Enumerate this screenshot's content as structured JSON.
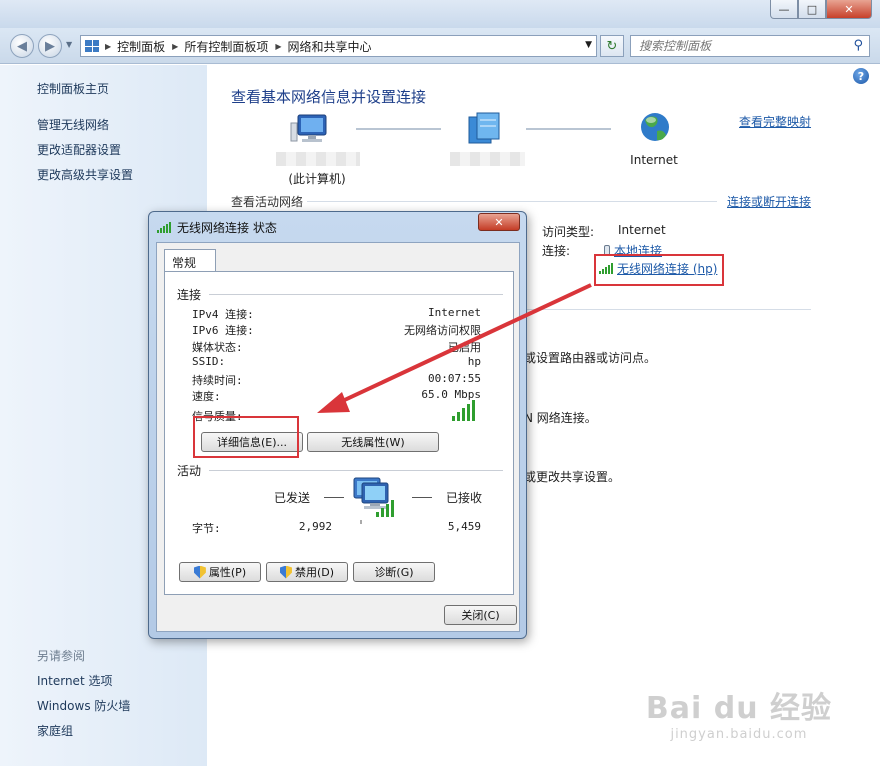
{
  "window": {
    "minimize": "—",
    "maximize": "□",
    "close": "✕"
  },
  "address_bar": {
    "breadcrumbs": [
      "控制面板",
      "所有控制面板项",
      "网络和共享中心"
    ],
    "search_placeholder": "搜索控制面板"
  },
  "sidebar": {
    "items": [
      "控制面板主页",
      "管理无线网络",
      "更改适配器设置",
      "更改高级共享设置"
    ],
    "see_also_title": "另请参阅",
    "see_also": [
      "Internet 选项",
      "Windows 防火墙",
      "家庭组"
    ]
  },
  "main": {
    "title": "查看基本网络信息并设置连接",
    "full_map_link": "查看完整映射",
    "computer_label": "(此计算机)",
    "internet_label": "Internet",
    "active_networks_title": "查看活动网络",
    "connect_link": "连接或断开连接",
    "access_type_label": "访问类型:",
    "access_type_value": "Internet",
    "connections_label": "连接:",
    "local_connection": "本地连接",
    "wireless_connection": "无线网络连接 (hp)",
    "task_fragments": [
      "或设置路由器或访问点。",
      "N 网络连接。",
      "或更改共享设置。"
    ]
  },
  "dialog": {
    "title": "无线网络连接 状态",
    "close": "✕",
    "tab": "常规",
    "connection_group": "连接",
    "rows": [
      {
        "label": "IPv4 连接:",
        "value": "Internet"
      },
      {
        "label": "IPv6 连接:",
        "value": "无网络访问权限"
      },
      {
        "label": "媒体状态:",
        "value": "已启用"
      },
      {
        "label": "SSID:",
        "value": "hp"
      },
      {
        "label": "持续时间:",
        "value": "00:07:55"
      },
      {
        "label": "速度:",
        "value": "65.0 Mbps"
      }
    ],
    "signal_label": "信号质量:",
    "details_button": "详细信息(E)...",
    "wireless_props_button": "无线属性(W)",
    "activity_group": "活动",
    "sent_label": "已发送",
    "received_label": "已接收",
    "bytes_label": "字节:",
    "bytes_sent": "2,992",
    "bytes_received": "5,459",
    "properties_button": "属性(P)",
    "disable_button": "禁用(D)",
    "diagnose_button": "诊断(G)",
    "close_button": "关闭(C)"
  },
  "watermark": {
    "brand": "Bai du 经验",
    "url": "jingyan.baidu.com"
  },
  "colors": {
    "link": "#1e5aa8",
    "heading": "#1e3f8a",
    "highlight": "#d9353a",
    "signal": "#2f9e2f"
  }
}
